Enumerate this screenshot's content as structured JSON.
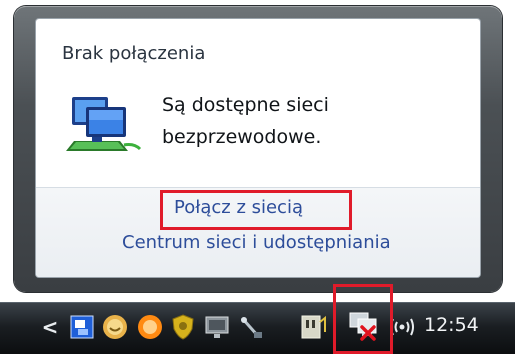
{
  "popup": {
    "status_title": "Brak połączenia",
    "message_line1": "Są dostępne sieci",
    "message_line2": "bezprzewodowe.",
    "connect_link": "Połącz z siecią",
    "center_link": "Centrum sieci i udostępniania"
  },
  "taskbar": {
    "clock": "12:54",
    "overflow_chevron": "<",
    "tray_icons": [
      "screen-icon",
      "messenger-icon",
      "orange-circle-icon",
      "security-shield-icon",
      "display-icon",
      "cable-icon",
      "usb-device-icon",
      "network-disconnected-icon",
      "wireless-icon"
    ]
  },
  "colors": {
    "link": "#2d4d9a",
    "highlight": "#e01b2a",
    "frame": "#4b5054",
    "taskbar": "#1a1e22"
  }
}
